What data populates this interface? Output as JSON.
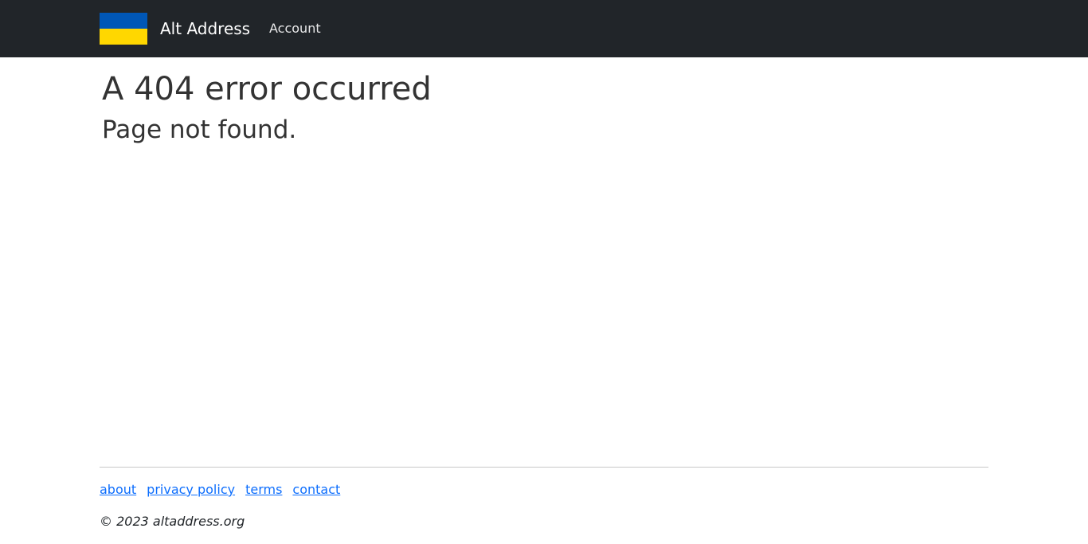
{
  "header": {
    "flag_icon": "ukraine-flag-icon",
    "flag_colors": {
      "top": "#0057b7",
      "bottom": "#ffd700"
    },
    "brand": "Alt Address",
    "nav": [
      {
        "label": "Account"
      }
    ]
  },
  "main": {
    "title": "A 404 error occurred",
    "subtitle": "Page not found."
  },
  "footer": {
    "links": [
      {
        "label": "about"
      },
      {
        "label": "privacy policy"
      },
      {
        "label": "terms"
      },
      {
        "label": "contact"
      }
    ],
    "copyright": "© 2023 altaddress.org"
  },
  "colors": {
    "navbar_bg": "#212529",
    "link": "#0d6efd",
    "text": "#333333"
  }
}
